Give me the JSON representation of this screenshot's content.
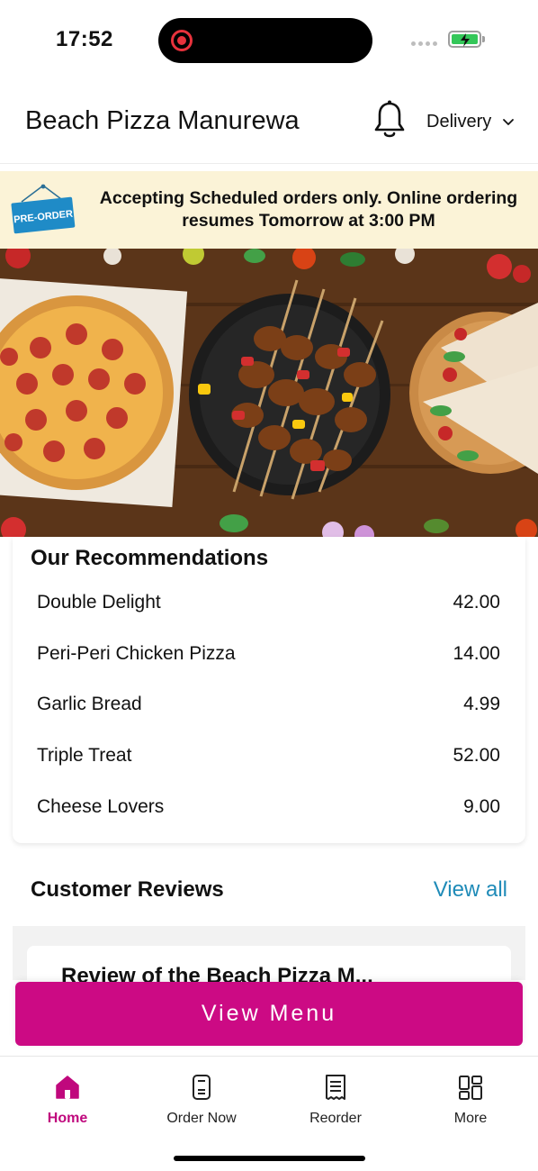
{
  "status_bar": {
    "time": "17:52",
    "icons": [
      "screen-record-icon",
      "signal-dots-icon",
      "battery-charging-icon"
    ]
  },
  "header": {
    "store_name": "Beach Pizza Manurewa",
    "delivery_label": "Delivery",
    "icons": [
      "bell-icon",
      "chevron-down-icon"
    ]
  },
  "banner": {
    "tag_label": "PRE-ORDER",
    "message": "Accepting Scheduled orders only. Online ordering resumes Tomorrow at 3:00 PM"
  },
  "recommendations": {
    "title": "Our Recommendations",
    "items": [
      {
        "name": "Double Delight",
        "price": "42.00"
      },
      {
        "name": "Peri-Peri Chicken Pizza",
        "price": "14.00"
      },
      {
        "name": "Garlic Bread",
        "price": "4.99"
      },
      {
        "name": "Triple Treat",
        "price": "52.00"
      },
      {
        "name": "Cheese Lovers",
        "price": "9.00"
      }
    ]
  },
  "reviews": {
    "title": "Customer Reviews",
    "view_all": "View all",
    "first_review_title": "Review of the Beach Pizza M..."
  },
  "view_menu_button": "View Menu",
  "tab_bar": {
    "tabs": [
      {
        "label": "Home",
        "icon": "home-icon",
        "active": true
      },
      {
        "label": "Order Now",
        "icon": "order-now-icon",
        "active": false
      },
      {
        "label": "Reorder",
        "icon": "receipt-icon",
        "active": false
      },
      {
        "label": "More",
        "icon": "grid-icon",
        "active": false
      }
    ]
  },
  "colors": {
    "accent": "#cc0a84",
    "link": "#1f8bb8",
    "banner_bg": "#fbf3d7",
    "tag_blue": "#1f8bc7"
  }
}
